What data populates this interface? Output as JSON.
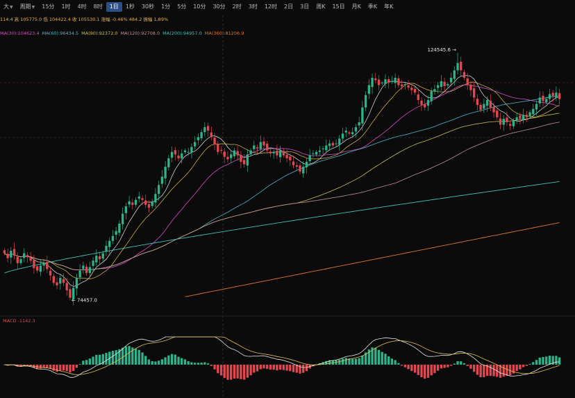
{
  "toolbar": {
    "items": [
      {
        "label": "大",
        "dropdown": true,
        "active": false
      },
      {
        "label": "周期",
        "dropdown": true,
        "active": false
      },
      {
        "label": "15分",
        "active": false
      },
      {
        "label": "1时",
        "active": false
      },
      {
        "label": "4时",
        "active": false
      },
      {
        "label": "8时",
        "active": false
      },
      {
        "label": "1日",
        "active": true
      },
      {
        "label": "1秒",
        "active": false
      },
      {
        "label": "30秒",
        "active": false
      },
      {
        "label": "1分",
        "active": false
      },
      {
        "label": "5分",
        "active": false
      },
      {
        "label": "10分",
        "active": false
      },
      {
        "label": "30分",
        "active": false
      },
      {
        "label": "2时",
        "active": false
      },
      {
        "label": "3时",
        "active": false
      },
      {
        "label": "12时",
        "active": false
      },
      {
        "label": "2日",
        "active": false
      },
      {
        "label": "3日",
        "active": false
      },
      {
        "label": "周K",
        "active": false
      },
      {
        "label": "15日",
        "active": false
      },
      {
        "label": "月K",
        "active": false
      },
      {
        "label": "季K",
        "active": false
      },
      {
        "label": "年K",
        "active": false
      }
    ]
  },
  "ohlc_text": "114.4 高 105775.0 低 104422.4 收 105530.1 涨幅 -0.46% 484.2 振幅 1.89%",
  "ma_legend": [
    {
      "label": "MA(30):104623.4",
      "color": "#d94cc4"
    },
    {
      "label": "MA(60):96434.5",
      "color": "#4fb6c9"
    },
    {
      "label": "MA(90):92372.0",
      "color": "#c9c14f"
    },
    {
      "label": "MA(120):92708.0",
      "color": "#c28f8f"
    },
    {
      "label": "MA(200):94957.0",
      "color": "#3fc4b4"
    },
    {
      "label": "MA(360):81206.9",
      "color": "#e0762e"
    }
  ],
  "macd_label": "MACD -1142.3",
  "chart_data": {
    "type": "candlestick",
    "price_range": [
      72000,
      127500
    ],
    "annotations": [
      {
        "label": "124545.6",
        "value": 124545.6,
        "kind": "high"
      },
      {
        "label": "74457.0",
        "value": 74457.0,
        "kind": "low"
      }
    ],
    "closes": [
      84000,
      83000,
      84500,
      83500,
      82000,
      82800,
      84000,
      83200,
      82500,
      81000,
      80500,
      81500,
      82000,
      80800,
      79500,
      78000,
      77500,
      79000,
      78000,
      76500,
      75000,
      77000,
      79000,
      80500,
      81500,
      80000,
      81200,
      82500,
      83500,
      82800,
      84000,
      85500,
      86500,
      87500,
      88500,
      90000,
      92000,
      93500,
      94500,
      93800,
      94800,
      95500,
      94800,
      93800,
      93200,
      94500,
      96000,
      97800,
      99500,
      101500,
      103200,
      104500,
      104000,
      103200,
      104200,
      104800,
      104500,
      105500,
      106500,
      107500,
      108500,
      109500,
      108800,
      107500,
      106000,
      104500,
      104800,
      103500,
      103000,
      104000,
      104800,
      103800,
      102500,
      102000,
      104000,
      104800,
      105800,
      105200,
      106500,
      105800,
      104800,
      104200,
      104500,
      103800,
      104800,
      103800,
      103200,
      102800,
      101800,
      101500,
      100500,
      101500,
      102500,
      103800,
      104200,
      104500,
      104800,
      105200,
      105800,
      106200,
      105800,
      106200,
      107200,
      108200,
      108800,
      108200,
      108500,
      109500,
      110500,
      113500,
      116000,
      118000,
      119500,
      119000,
      118000,
      118500,
      119200,
      118500,
      118800,
      119500,
      118000,
      117800,
      118200,
      117500,
      117000,
      116500,
      115000,
      114000,
      113500,
      115000,
      116800,
      117200,
      118000,
      118800,
      117800,
      118200,
      119500,
      121000,
      122500,
      121000,
      119500,
      118000,
      117000,
      115500,
      114000,
      113000,
      114200,
      115000,
      113500,
      112500,
      111500,
      110000,
      111200,
      110500,
      109800,
      110800,
      111500,
      111200,
      112000,
      111500,
      112500,
      113200,
      114200,
      115500,
      114800,
      115200,
      116200,
      115800,
      116500,
      115200
    ]
  },
  "colors": {
    "up": "#2fb38b",
    "down": "#e2484f",
    "background": "#0b0b0c"
  }
}
